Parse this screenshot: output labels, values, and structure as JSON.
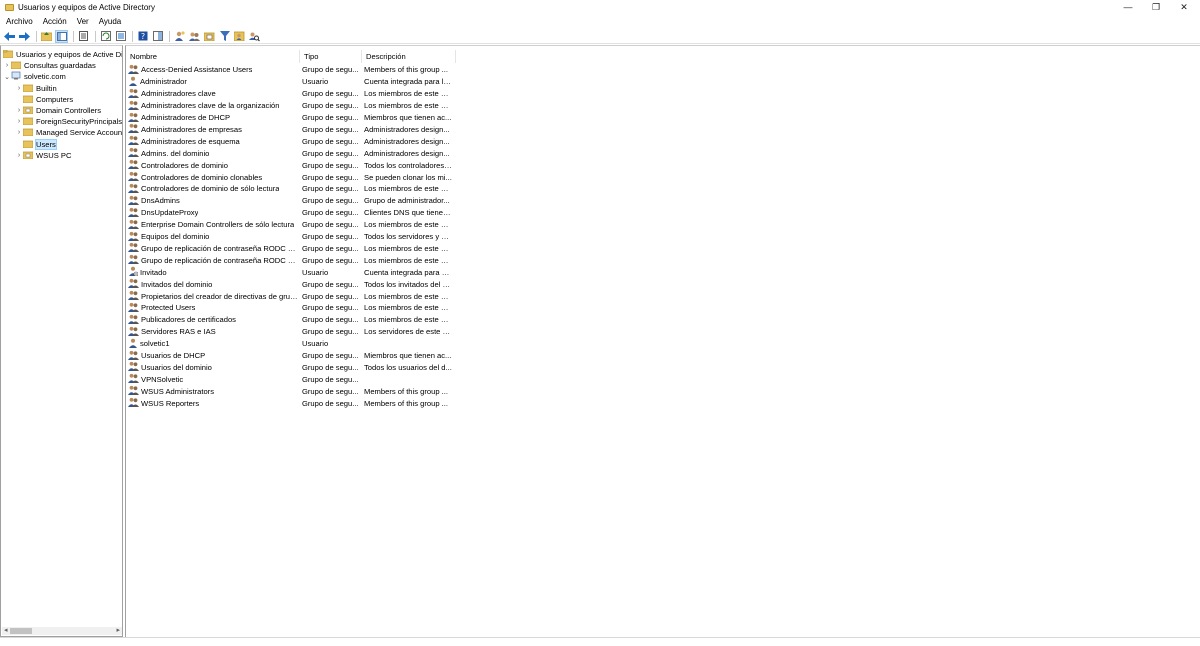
{
  "window": {
    "title": "Usuarios y equipos de Active Directory",
    "icon": "folder-icon",
    "controls": [
      "—",
      "❐",
      "✕"
    ]
  },
  "menubar": [
    "Archivo",
    "Acción",
    "Ver",
    "Ayuda"
  ],
  "toolbar": {
    "icons": [
      "back-arrow-icon",
      "forward-arrow-icon",
      "up-folder-icon",
      "show-tree-icon",
      "properties-icon",
      "refresh-icon",
      "export-list-icon",
      "help-icon",
      "show-help-icon",
      "new-user-icon",
      "new-group-icon",
      "new-ou-icon",
      "filter-icon",
      "add-to-group-icon",
      "find-icon"
    ]
  },
  "tree": {
    "root": "Usuarios y equipos de Active Directory",
    "saved_queries": "Consultas guardadas",
    "domain": "solvetic.com",
    "containers": [
      "Builtin",
      "Computers",
      "Domain Controllers",
      "ForeignSecurityPrincipals",
      "Managed Service Accounts",
      "Users",
      "WSUS PC"
    ],
    "selected": "Users"
  },
  "list": {
    "columns": [
      "Nombre",
      "Tipo",
      "Descripción"
    ],
    "rows": [
      {
        "name": "Access-Denied Assistance Users",
        "type": "Grupo de segu...",
        "desc": "Members of this group ...",
        "icon": "group"
      },
      {
        "name": "Administrador",
        "type": "Usuario",
        "desc": "Cuenta integrada para la...",
        "icon": "user"
      },
      {
        "name": "Administradores clave",
        "type": "Grupo de segu...",
        "desc": "Los miembros de este gr...",
        "icon": "group"
      },
      {
        "name": "Administradores clave de la organización",
        "type": "Grupo de segu...",
        "desc": "Los miembros de este gr...",
        "icon": "group"
      },
      {
        "name": "Administradores de DHCP",
        "type": "Grupo de segu...",
        "desc": "Miembros que tienen ac...",
        "icon": "group"
      },
      {
        "name": "Administradores de empresas",
        "type": "Grupo de segu...",
        "desc": "Administradores design...",
        "icon": "group"
      },
      {
        "name": "Administradores de esquema",
        "type": "Grupo de segu...",
        "desc": "Administradores design...",
        "icon": "group"
      },
      {
        "name": "Admins. del dominio",
        "type": "Grupo de segu...",
        "desc": "Administradores design...",
        "icon": "group"
      },
      {
        "name": "Controladores de dominio",
        "type": "Grupo de segu...",
        "desc": "Todos los controladores ...",
        "icon": "group"
      },
      {
        "name": "Controladores de dominio clonables",
        "type": "Grupo de segu...",
        "desc": "Se pueden clonar los mi...",
        "icon": "group"
      },
      {
        "name": "Controladores de dominio de sólo lectura",
        "type": "Grupo de segu...",
        "desc": "Los miembros de este gr...",
        "icon": "group"
      },
      {
        "name": "DnsAdmins",
        "type": "Grupo de segu...",
        "desc": "Grupo de administrador...",
        "icon": "group"
      },
      {
        "name": "DnsUpdateProxy",
        "type": "Grupo de segu...",
        "desc": "Clientes DNS que tienen...",
        "icon": "group"
      },
      {
        "name": "Enterprise Domain Controllers de sólo lectura",
        "type": "Grupo de segu...",
        "desc": "Los miembros de este gr...",
        "icon": "group"
      },
      {
        "name": "Equipos del dominio",
        "type": "Grupo de segu...",
        "desc": "Todos los servidores y es...",
        "icon": "group"
      },
      {
        "name": "Grupo de replicación de contraseña RODC de...",
        "type": "Grupo de segu...",
        "desc": "Los miembros de este gr...",
        "icon": "group"
      },
      {
        "name": "Grupo de replicación de contraseña RODC per...",
        "type": "Grupo de segu...",
        "desc": "Los miembros de este gr...",
        "icon": "group"
      },
      {
        "name": "Invitado",
        "type": "Usuario",
        "desc": "Cuenta integrada para el...",
        "icon": "user-disabled"
      },
      {
        "name": "Invitados del dominio",
        "type": "Grupo de segu...",
        "desc": "Todos los invitados del d...",
        "icon": "group"
      },
      {
        "name": "Propietarios del creador de directivas de grupo",
        "type": "Grupo de segu...",
        "desc": "Los miembros de este gr...",
        "icon": "group"
      },
      {
        "name": "Protected Users",
        "type": "Grupo de segu...",
        "desc": "Los miembros de este gr...",
        "icon": "group"
      },
      {
        "name": "Publicadores de certificados",
        "type": "Grupo de segu...",
        "desc": "Los miembros de este gr...",
        "icon": "group"
      },
      {
        "name": "Servidores RAS e IAS",
        "type": "Grupo de segu...",
        "desc": "Los servidores de este gr...",
        "icon": "group"
      },
      {
        "name": "solvetic1",
        "type": "Usuario",
        "desc": "",
        "icon": "user"
      },
      {
        "name": "Usuarios de DHCP",
        "type": "Grupo de segu...",
        "desc": "Miembros que tienen ac...",
        "icon": "group"
      },
      {
        "name": "Usuarios del dominio",
        "type": "Grupo de segu...",
        "desc": "Todos los usuarios del d...",
        "icon": "group"
      },
      {
        "name": "VPNSolvetic",
        "type": "Grupo de segu...",
        "desc": "",
        "icon": "group"
      },
      {
        "name": "WSUS Administrators",
        "type": "Grupo de segu...",
        "desc": "Members of this group ...",
        "icon": "group"
      },
      {
        "name": "WSUS Reporters",
        "type": "Grupo de segu...",
        "desc": "Members of this group ...",
        "icon": "group"
      }
    ]
  },
  "colors": {
    "folder": "#e8c35c",
    "selection": "#cce8ff",
    "toolbar_blue": "#1e6fc4"
  }
}
